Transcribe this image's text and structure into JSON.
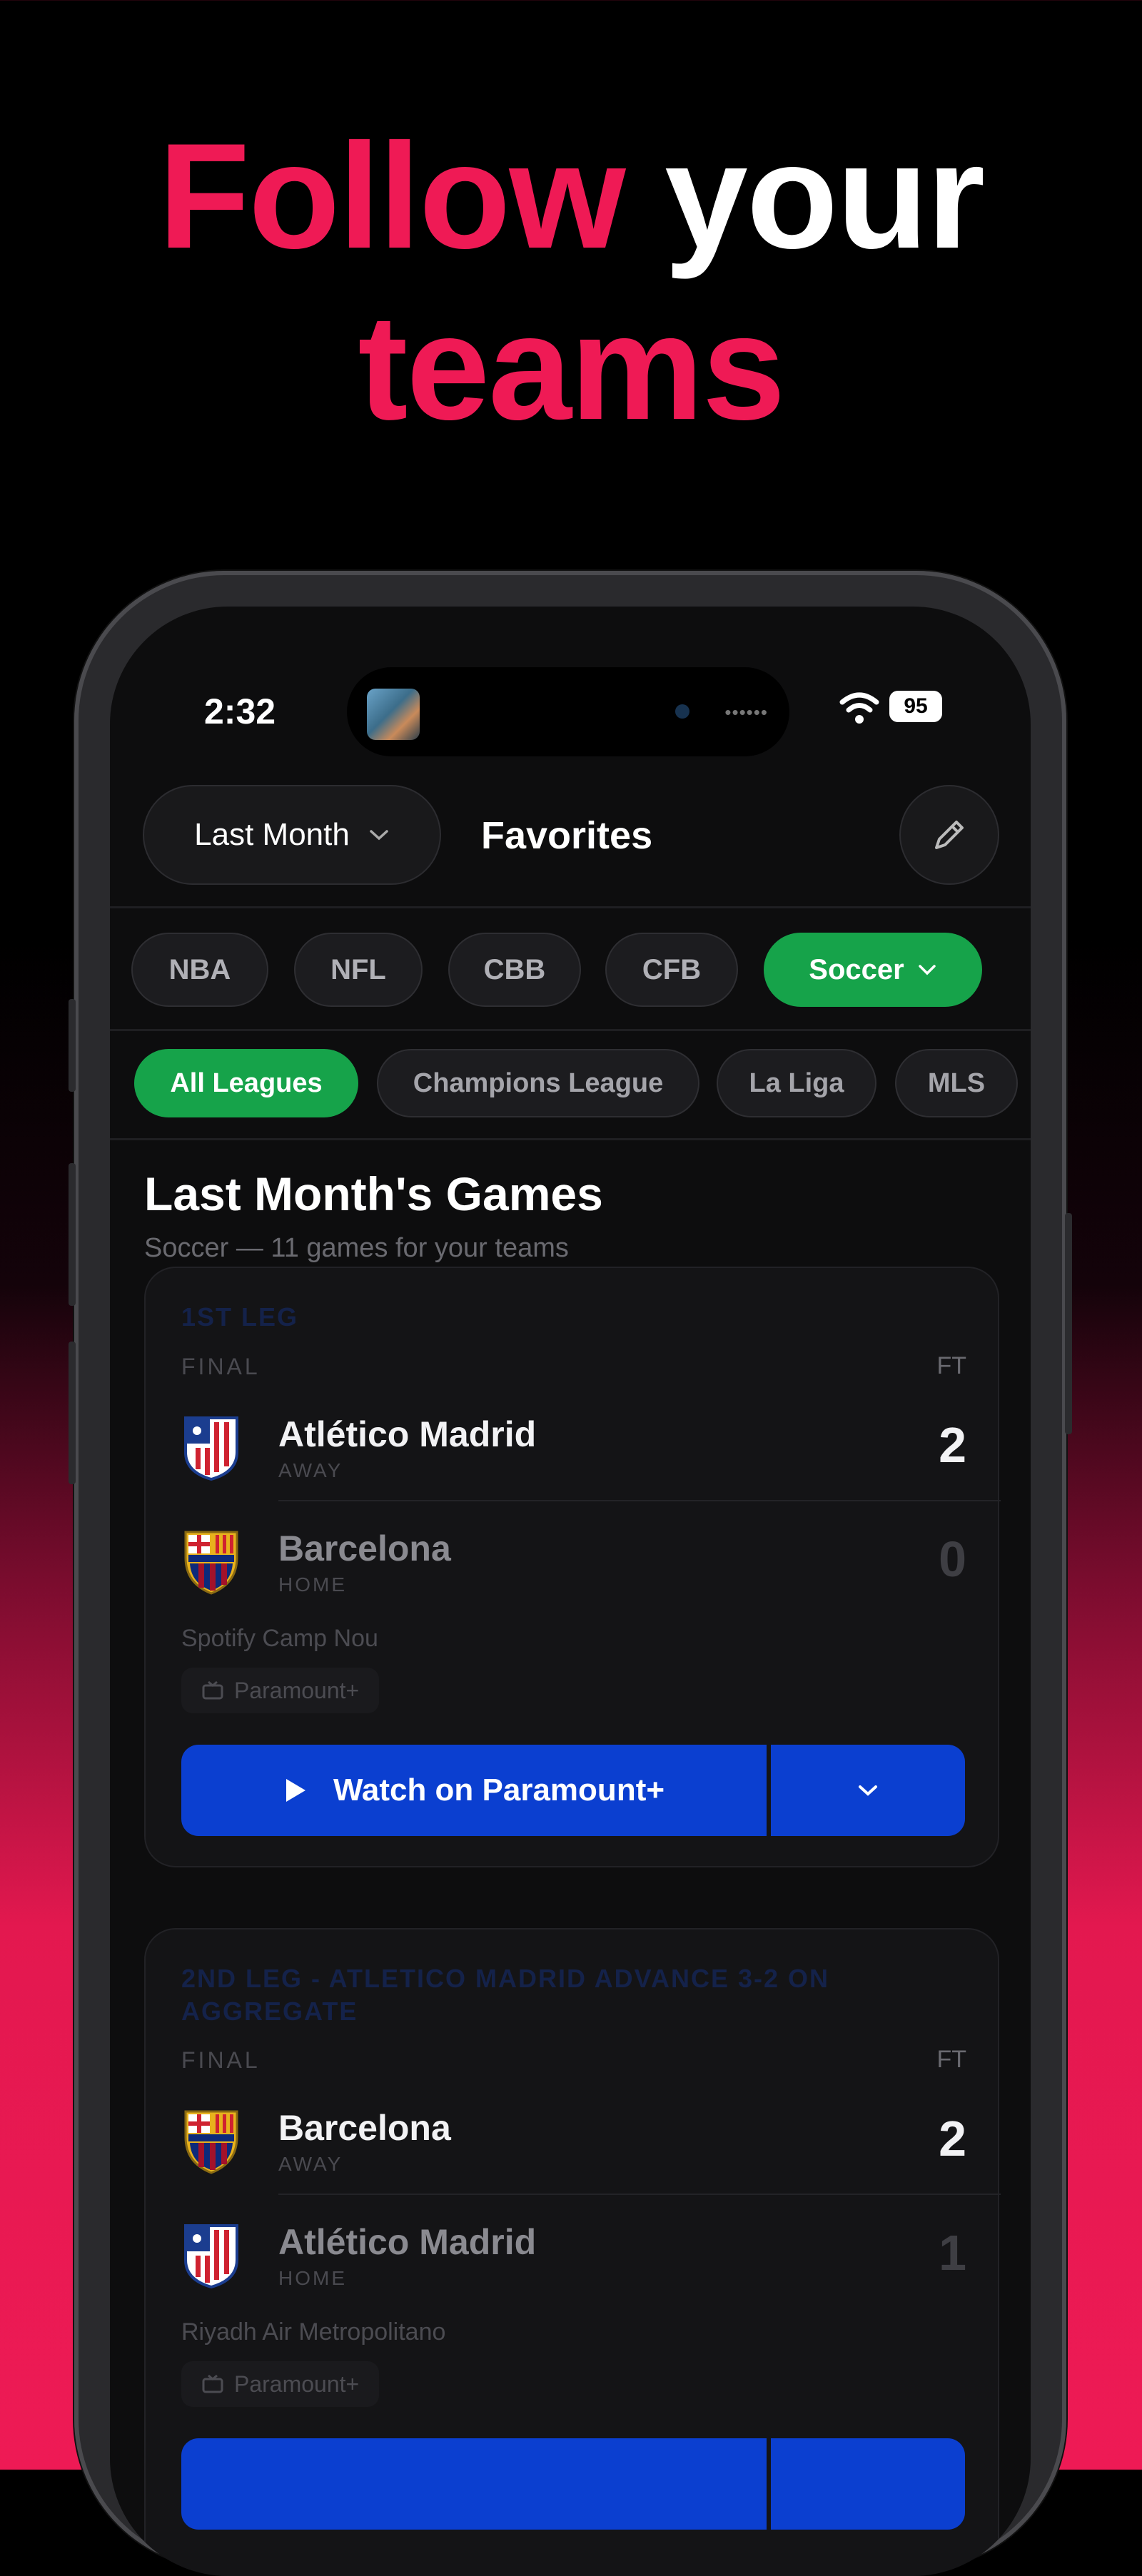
{
  "headline": {
    "word1": "Follow",
    "word2": "your",
    "word3": "teams"
  },
  "status_bar": {
    "time": "2:32",
    "battery": "95"
  },
  "header": {
    "range_label": "Last Month",
    "title": "Favorites"
  },
  "sports": [
    {
      "label": "NBA"
    },
    {
      "label": "NFL"
    },
    {
      "label": "CBB"
    },
    {
      "label": "CFB"
    },
    {
      "label": "Soccer",
      "active": true
    }
  ],
  "leagues": [
    {
      "label": "All Leagues",
      "active": true
    },
    {
      "label": "Champions League"
    },
    {
      "label": "La Liga"
    },
    {
      "label": "MLS"
    }
  ],
  "section": {
    "title": "Last Month's Games",
    "subtitle": "Soccer — 11 games for your teams"
  },
  "games": [
    {
      "leg": "1ST LEG",
      "status": "FINAL",
      "period": "FT",
      "teams": [
        {
          "name": "Atlético Madrid",
          "role": "AWAY",
          "score": "2",
          "crest": "atletico-crest-icon"
        },
        {
          "name": "Barcelona",
          "role": "HOME",
          "score": "0",
          "crest": "barcelona-crest-icon"
        }
      ],
      "venue": "Spotify Camp Nou",
      "network": "Paramount+",
      "watch_label": "Watch on Paramount+"
    },
    {
      "leg": "2ND LEG - ATLETICO MADRID ADVANCE 3-2 ON AGGREGATE",
      "status": "FINAL",
      "period": "FT",
      "teams": [
        {
          "name": "Barcelona",
          "role": "AWAY",
          "score": "2",
          "crest": "barcelona-crest-icon"
        },
        {
          "name": "Atlético Madrid",
          "role": "HOME",
          "score": "1",
          "crest": "atletico-crest-icon"
        }
      ],
      "venue": "Riyadh Air Metropolitano",
      "network": "Paramount+",
      "watch_label": ""
    }
  ],
  "colors": {
    "accent_pink": "#ef1a55",
    "active_green": "#16a34a",
    "watch_blue": "#0b3fd0"
  }
}
